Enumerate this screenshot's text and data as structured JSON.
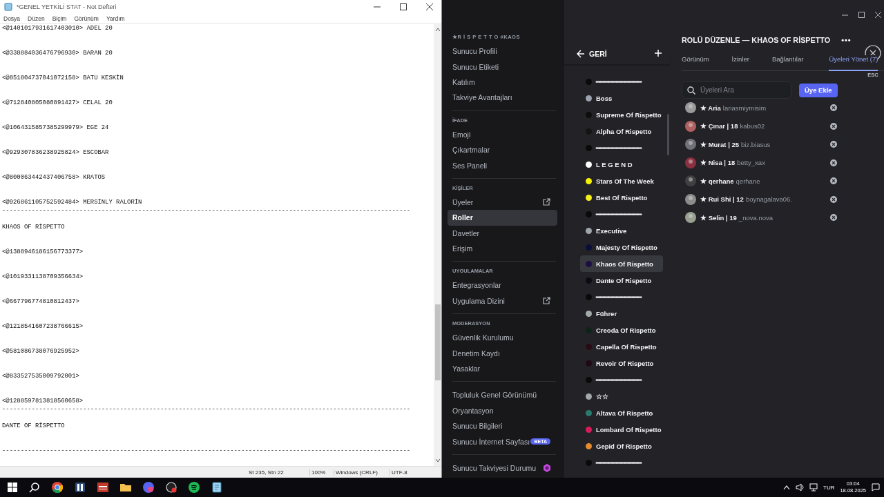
{
  "notepad": {
    "title": "*GENEL YETKİLİ STAT - Not Defteri",
    "menu": [
      "Dosya",
      "Düzen",
      "Biçim",
      "Görünüm",
      "Yardım"
    ],
    "lines": [
      {
        "kind": "entry",
        "text": "<@1401017931617403010> ADEL 20"
      },
      {
        "kind": "entry",
        "text": "<@338884036476796930> BARAN 20"
      },
      {
        "kind": "entry",
        "text": "<@851804737041072158> BATU KESKİN"
      },
      {
        "kind": "entry",
        "text": "<@712840805080891427> CELAL 20"
      },
      {
        "kind": "entry",
        "text": "<@1064315857385299979> EGE 24"
      },
      {
        "kind": "entry",
        "text": "<@929307836238925824> ESCOBAR"
      },
      {
        "kind": "entry",
        "text": "<@800063442437406758> KRATOS"
      },
      {
        "kind": "entry",
        "text": "<@926861105752592484> MERSİNLY RALORİN"
      },
      {
        "kind": "rule",
        "text": "---------------------------------------------------------------------------------------------------------------"
      },
      {
        "kind": "heading",
        "text": "KHAOS OF RİSPETTO"
      },
      {
        "kind": "entry",
        "text": "<@1388946186156773377>"
      },
      {
        "kind": "entry",
        "text": "<@1019331138709356634>"
      },
      {
        "kind": "entry",
        "text": "<@667796774810812437>"
      },
      {
        "kind": "entry",
        "text": "<@1218541607238766615>"
      },
      {
        "kind": "entry",
        "text": "<@581086738076925952>"
      },
      {
        "kind": "entry",
        "text": "<@833527535009792001>"
      },
      {
        "kind": "entry",
        "text": "<@1288597813818560658>"
      },
      {
        "kind": "rule",
        "text": "---------------------------------------------------------------------------------------------------------------"
      },
      {
        "kind": "heading",
        "text": "DANTE OF RİSPETTO"
      },
      {
        "kind": "rule",
        "text": "---------------------------------------------------------------------------------------------------------------"
      }
    ],
    "status": [
      "St 235, Stn 22",
      "100%",
      "Windows (CRLF)",
      "UTF-8"
    ]
  },
  "discord": {
    "sidebar": {
      "server": "★R İ S P E T T O #KAOS",
      "sections": [
        {
          "items": [
            {
              "kind": "page",
              "label": "Sunucu Profili",
              "selected": false
            },
            {
              "kind": "page",
              "label": "Sunucu Etiketi",
              "selected": false
            },
            {
              "kind": "page",
              "label": "Katılım",
              "selected": false
            },
            {
              "kind": "page",
              "label": "Takviye Avantajları",
              "selected": false
            }
          ]
        },
        {
          "label": "İFADE",
          "items": [
            {
              "kind": "page",
              "label": "Emoji",
              "selected": false
            },
            {
              "kind": "page",
              "label": "Çıkartmalar",
              "selected": false
            },
            {
              "kind": "page",
              "label": "Ses Paneli",
              "selected": false
            }
          ]
        },
        {
          "label": "KİŞİLER",
          "items": [
            {
              "kind": "external",
              "label": "Üyeler",
              "selected": false
            },
            {
              "kind": "page",
              "label": "Roller",
              "selected": true
            },
            {
              "kind": "page",
              "label": "Davetler",
              "selected": false
            },
            {
              "kind": "page",
              "label": "Erişim",
              "selected": false
            }
          ]
        },
        {
          "label": "UYGULAMALAR",
          "items": [
            {
              "kind": "page",
              "label": "Entegrasyonlar",
              "selected": false
            },
            {
              "kind": "external",
              "label": "Uygulama Dizini",
              "selected": false
            }
          ]
        },
        {
          "label": "MODERASYON",
          "items": [
            {
              "kind": "page",
              "label": "Güvenlik Kurulumu",
              "selected": false
            },
            {
              "kind": "page",
              "label": "Denetim Kaydı",
              "selected": false
            },
            {
              "kind": "page",
              "label": "Yasaklar",
              "selected": false
            }
          ]
        },
        {
          "items": [
            {
              "kind": "page",
              "label": "Topluluk Genel Görünümü",
              "selected": false
            },
            {
              "kind": "page",
              "label": "Oryantasyon",
              "selected": false
            },
            {
              "kind": "page",
              "label": "Sunucu Bilgileri",
              "selected": false
            },
            {
              "kind": "page",
              "label": "Sunucu İnternet Sayfası",
              "selected": false,
              "badge": "BETA"
            }
          ]
        },
        {
          "items": [
            {
              "kind": "boost",
              "label": "Sunucu Takviyesi Durumu",
              "selected": false
            }
          ]
        }
      ]
    },
    "roles": {
      "back": "GERİ",
      "items": [
        {
          "name": "━━━━━━━━━━━",
          "color": "#0a0a0a",
          "selected": false
        },
        {
          "name": "Boss",
          "color": "#9ca3af",
          "selected": false
        },
        {
          "name": "Supreme Of Rispetto",
          "color": "#0d0d0d",
          "selected": false
        },
        {
          "name": "Alpha Of Rispetto",
          "color": "#141414",
          "selected": false
        },
        {
          "name": "━━━━━━━━━━━",
          "color": "#0a0a0a",
          "selected": false
        },
        {
          "name": "L E G E N D",
          "color": "#ffffff",
          "selected": false
        },
        {
          "name": "Stars Of The Week",
          "color": "#f5f200",
          "selected": false
        },
        {
          "name": "Best Of Rispetto",
          "color": "#f5ef1a",
          "selected": false
        },
        {
          "name": "━━━━━━━━━━━",
          "color": "#0a0a0a",
          "selected": false
        },
        {
          "name": "Executive",
          "color": "#a0a4ab",
          "selected": false
        },
        {
          "name": "Majesty Of Rispetto",
          "color": "#0a0f3a",
          "selected": false
        },
        {
          "name": "Khaos Of Rispetto",
          "color": "#1a0f40",
          "selected": true
        },
        {
          "name": "Dante Of Rispetto",
          "color": "#0d0a14",
          "selected": false
        },
        {
          "name": "━━━━━━━━━━━",
          "color": "#0a0a0a",
          "selected": false
        },
        {
          "name": "Führer",
          "color": "#a3aaa8",
          "selected": false
        },
        {
          "name": "Creoda Of Rispetto",
          "color": "#0f2419",
          "selected": false
        },
        {
          "name": "Capella Of Rispetto",
          "color": "#2a0a14",
          "selected": false
        },
        {
          "name": "Revoir Of Rispetto",
          "color": "#1f0a14",
          "selected": false
        },
        {
          "name": "━━━━━━━━━━━",
          "color": "#0a0a0a",
          "selected": false
        },
        {
          "name": "☆☆",
          "color": "#a3a9a8",
          "selected": false
        },
        {
          "name": "Altava Of Rispetto",
          "color": "#2a7a6c",
          "selected": false
        },
        {
          "name": "Lombard Of Rispetto",
          "color": "#d81b5a",
          "selected": false
        },
        {
          "name": "Gepid Of Rispetto",
          "color": "#e68a2e",
          "selected": false
        },
        {
          "name": "━━━━━━━━━━━",
          "color": "#0a0a0a",
          "selected": false
        }
      ]
    },
    "editor": {
      "title": "ROLÜ DÜZENLE — KHAOS OF RİSPETTO",
      "more": "•••",
      "tabs": [
        {
          "label": "Görünüm",
          "selected": false
        },
        {
          "label": "İzinler",
          "selected": false
        },
        {
          "label": "Bağlantılar",
          "selected": false
        },
        {
          "label": "Üyeleri Yönet (7)",
          "selected": true
        }
      ],
      "close_hint": "ESC",
      "search": {
        "placeholder": "Üyeleri Ara"
      },
      "add_button": "Üye Ekle",
      "members": [
        {
          "name": "★ Aria",
          "username": "lariasmiymisim"
        },
        {
          "name": "★ Çınar | 18",
          "username": "kabus02"
        },
        {
          "name": "★ Murat | 25",
          "username": "biz.biasus"
        },
        {
          "name": "★ Nisa | 18",
          "username": "betty_xax"
        },
        {
          "name": "★ qerhane",
          "username": "qerhane"
        },
        {
          "name": "★ Rui Shi | 12",
          "username": "boynagalava06."
        },
        {
          "name": "★ Selin | 19",
          "username": "_nova.nova"
        }
      ]
    }
  },
  "taskbar": {
    "language": "TUR",
    "time": "03:04",
    "date": "18.08.2025"
  }
}
